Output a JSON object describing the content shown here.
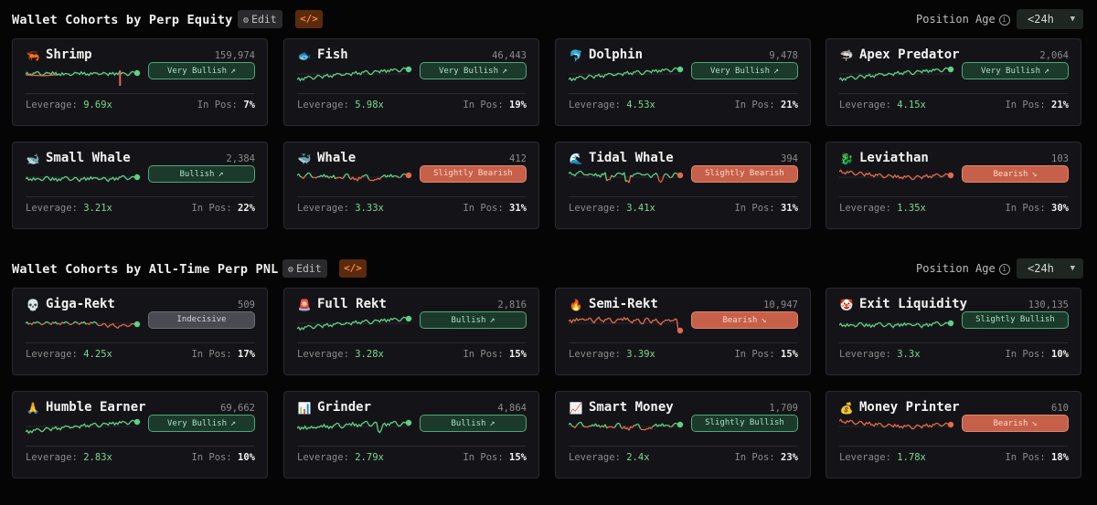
{
  "colors": {
    "bullish_line": "#5fd186",
    "bearish_line": "#e36a4a",
    "leverage_value": "#7dd98f",
    "code_button_bg": "#5a2a0c",
    "code_button_fg": "#ff8a3d",
    "background": "#050506",
    "card_bg": "#141418"
  },
  "sections": [
    {
      "title": "Wallet Cohorts by Perp Equity",
      "edit_label": "Edit",
      "code_icon": "</>",
      "position_age_label": "Position Age",
      "info_icon": "i",
      "age_value": "<24h",
      "leverage_label": "Leverage:",
      "in_pos_label": "In Pos:",
      "cards": [
        {
          "icon": "shrimp-icon",
          "emoji": "🦐",
          "name": "Shrimp",
          "count": "159,974",
          "sentiment": "Very Bullish",
          "tone": "bull",
          "arrow": "↗",
          "leverage": "9.69x",
          "in_pos": "7%",
          "trend": "spike"
        },
        {
          "icon": "fish-icon",
          "emoji": "🐟",
          "name": "Fish",
          "count": "46,443",
          "sentiment": "Very Bullish",
          "tone": "bull",
          "arrow": "↗",
          "leverage": "5.98x",
          "in_pos": "19%",
          "trend": "up"
        },
        {
          "icon": "dolphin-icon",
          "emoji": "🐬",
          "name": "Dolphin",
          "count": "9,478",
          "sentiment": "Very Bullish",
          "tone": "bull",
          "arrow": "↗",
          "leverage": "4.53x",
          "in_pos": "21%",
          "trend": "up"
        },
        {
          "icon": "shark-icon",
          "emoji": "🦈",
          "name": "Apex Predator",
          "count": "2,064",
          "sentiment": "Very Bullish",
          "tone": "bull",
          "arrow": "↗",
          "leverage": "4.15x",
          "in_pos": "21%",
          "trend": "up"
        },
        {
          "icon": "small-whale-icon",
          "emoji": "🐋",
          "name": "Small Whale",
          "count": "2,384",
          "sentiment": "Bullish",
          "tone": "bull",
          "arrow": "↗",
          "leverage": "3.21x",
          "in_pos": "22%",
          "trend": "flat-up"
        },
        {
          "icon": "whale-icon",
          "emoji": "🐳",
          "name": "Whale",
          "count": "412",
          "sentiment": "Slightly Bearish",
          "tone": "bear",
          "arrow": "",
          "leverage": "3.33x",
          "in_pos": "31%",
          "trend": "mixed"
        },
        {
          "icon": "wave-icon",
          "emoji": "🌊",
          "name": "Tidal Whale",
          "count": "394",
          "sentiment": "Slightly Bearish",
          "tone": "bear",
          "arrow": "",
          "leverage": "3.41x",
          "in_pos": "31%",
          "trend": "choppy-down"
        },
        {
          "icon": "dragon-icon",
          "emoji": "🐉",
          "name": "Leviathan",
          "count": "103",
          "sentiment": "Bearish",
          "tone": "bear",
          "arrow": "↘",
          "leverage": "1.35x",
          "in_pos": "30%",
          "trend": "down"
        }
      ]
    },
    {
      "title": "Wallet Cohorts by All-Time Perp PNL",
      "edit_label": "Edit",
      "code_icon": "</>",
      "position_age_label": "Position Age",
      "info_icon": "i",
      "age_value": "<24h",
      "leverage_label": "Leverage:",
      "in_pos_label": "In Pos:",
      "cards": [
        {
          "icon": "skull-icon",
          "emoji": "💀",
          "name": "Giga-Rekt",
          "count": "509",
          "sentiment": "Indecisive",
          "tone": "neut",
          "arrow": "",
          "leverage": "4.25x",
          "in_pos": "17%",
          "trend": "dip"
        },
        {
          "icon": "siren-icon",
          "emoji": "🚨",
          "name": "Full Rekt",
          "count": "2,816",
          "sentiment": "Bullish",
          "tone": "bull",
          "arrow": "↗",
          "leverage": "3.28x",
          "in_pos": "15%",
          "trend": "up"
        },
        {
          "icon": "fire-icon",
          "emoji": "🔥",
          "name": "Semi-Rekt",
          "count": "10,947",
          "sentiment": "Bearish",
          "tone": "bear",
          "arrow": "↘",
          "leverage": "3.39x",
          "in_pos": "15%",
          "trend": "drop"
        },
        {
          "icon": "clown-icon",
          "emoji": "🤡",
          "name": "Exit Liquidity",
          "count": "130,135",
          "sentiment": "Slightly Bullish",
          "tone": "bull",
          "arrow": "",
          "leverage": "3.3x",
          "in_pos": "10%",
          "trend": "flat-up"
        },
        {
          "icon": "pray-icon",
          "emoji": "🙏",
          "name": "Humble Earner",
          "count": "69,662",
          "sentiment": "Very Bullish",
          "tone": "bull",
          "arrow": "↗",
          "leverage": "2.83x",
          "in_pos": "10%",
          "trend": "up"
        },
        {
          "icon": "bar-chart-icon",
          "emoji": "📊",
          "name": "Grinder",
          "count": "4,864",
          "sentiment": "Bullish",
          "tone": "bull",
          "arrow": "↗",
          "leverage": "2.79x",
          "in_pos": "15%",
          "trend": "choppy-up"
        },
        {
          "icon": "chart-up-icon",
          "emoji": "📈",
          "name": "Smart Money",
          "count": "1,709",
          "sentiment": "Slightly Bullish",
          "tone": "bull",
          "arrow": "",
          "leverage": "2.4x",
          "in_pos": "23%",
          "trend": "mixed"
        },
        {
          "icon": "money-bag-icon",
          "emoji": "💰",
          "name": "Money Printer",
          "count": "610",
          "sentiment": "Bearish",
          "tone": "bear",
          "arrow": "↘",
          "leverage": "1.78x",
          "in_pos": "18%",
          "trend": "down"
        }
      ]
    }
  ]
}
